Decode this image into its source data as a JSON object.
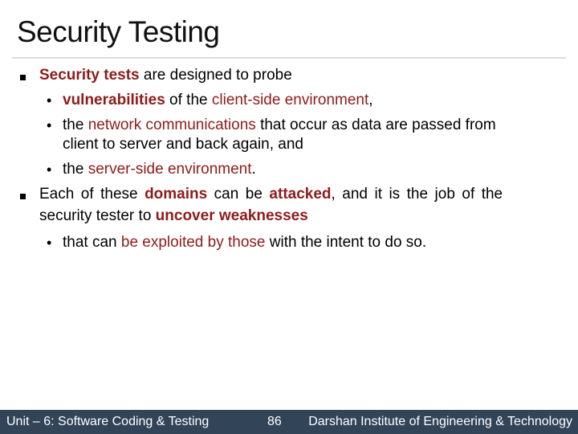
{
  "slide": {
    "title": "Security Testing",
    "accent_color": "#8e1b1b",
    "bullets": [
      {
        "level": 1,
        "icon": "square-bullet-icon",
        "segments": [
          {
            "text": "Security tests",
            "style": "accent-bold"
          },
          {
            "text": " are designed to probe",
            "style": "normal"
          }
        ]
      },
      {
        "level": 2,
        "icon": "dot-bullet-icon",
        "segments": [
          {
            "text": "vulnerabilities",
            "style": "accent-bold"
          },
          {
            "text": " of the ",
            "style": "normal"
          },
          {
            "text": "client-side environment",
            "style": "accent"
          },
          {
            "text": ",",
            "style": "normal"
          }
        ]
      },
      {
        "level": 2,
        "icon": "dot-bullet-icon",
        "segments": [
          {
            "text": "the ",
            "style": "normal"
          },
          {
            "text": "network communications",
            "style": "accent"
          },
          {
            "text": " that occur as data are passed from",
            "style": "normal"
          }
        ],
        "continuation": "client to server and back again, and"
      },
      {
        "level": 2,
        "icon": "dot-bullet-icon",
        "segments": [
          {
            "text": "the ",
            "style": "normal"
          },
          {
            "text": "server-side environment",
            "style": "accent"
          },
          {
            "text": ".",
            "style": "normal"
          }
        ]
      },
      {
        "level": 1,
        "icon": "square-bullet-icon",
        "segments": [
          {
            "text": "Each of these ",
            "style": "normal"
          },
          {
            "text": "domains",
            "style": "accent-bold"
          },
          {
            "text": " can be ",
            "style": "normal"
          },
          {
            "text": "attacked",
            "style": "accent-bold"
          },
          {
            "text": ", and it is the job of the",
            "style": "normal"
          }
        ],
        "continuation_segments": [
          {
            "text": "security tester to ",
            "style": "normal"
          },
          {
            "text": "uncover weaknesses",
            "style": "accent-bold"
          }
        ]
      },
      {
        "level": 2,
        "icon": "dot-bullet-icon",
        "segments": [
          {
            "text": "that can ",
            "style": "normal"
          },
          {
            "text": "be exploited by those",
            "style": "accent"
          },
          {
            "text": " with the intent to do so.",
            "style": "normal"
          }
        ]
      }
    ]
  },
  "footer": {
    "unit": "Unit – 6: Software Coding & Testing",
    "page_number": "86",
    "institute": "Darshan Institute of Engineering & Technology",
    "background_color": "#324458"
  }
}
